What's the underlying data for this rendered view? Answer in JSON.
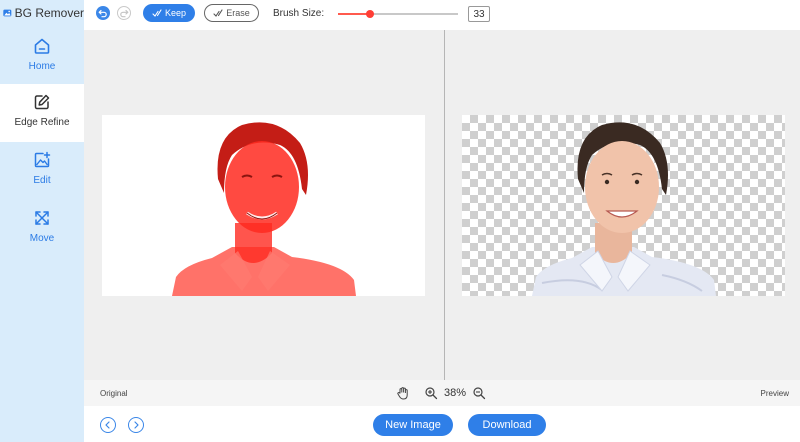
{
  "app": {
    "title": "BG Remover"
  },
  "sidebar": {
    "items": [
      {
        "label": "Home",
        "icon": "home-icon"
      },
      {
        "label": "Edge Refine",
        "icon": "edit-square-icon",
        "active": true
      },
      {
        "label": "Edit",
        "icon": "image-edit-icon"
      },
      {
        "label": "Move",
        "icon": "move-arrows-icon"
      }
    ]
  },
  "toolbar": {
    "keep_label": "Keep",
    "erase_label": "Erase",
    "brush_size_label": "Brush Size:",
    "brush_size_value": "33",
    "brush_slider_fraction": 0.27
  },
  "canvas": {
    "original_label": "Original",
    "preview_label": "Preview",
    "zoom": "38%"
  },
  "footer": {
    "new_image_label": "New Image",
    "download_label": "Download"
  },
  "colors": {
    "accent": "#2f7fe8",
    "sidebar_bg": "#d9ecfb",
    "mask_red": "#ff3b2f"
  }
}
